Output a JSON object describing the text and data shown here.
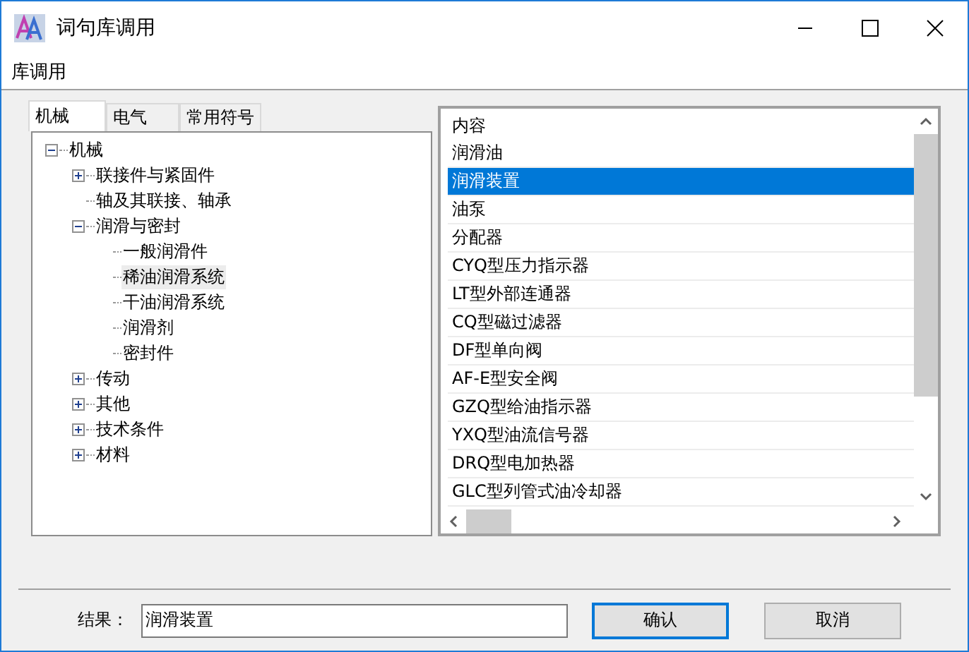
{
  "window": {
    "title": "词句库调用"
  },
  "menu": [
    "库调用"
  ],
  "tabs": [
    {
      "label": "机械",
      "selected": true
    },
    {
      "label": "电气",
      "selected": false
    },
    {
      "label": "常用符号",
      "selected": false
    }
  ],
  "tree": [
    {
      "label": "机械",
      "expanded": true,
      "selected": false,
      "children": [
        {
          "label": "联接件与紧固件",
          "expanded": false,
          "selected": false
        },
        {
          "label": "轴及其联接、轴承",
          "selected": false
        },
        {
          "label": "润滑与密封",
          "expanded": true,
          "selected": false,
          "children": [
            {
              "label": "一般润滑件",
              "selected": false
            },
            {
              "label": "稀油润滑系统",
              "selected": true
            },
            {
              "label": "干油润滑系统",
              "selected": false
            },
            {
              "label": "润滑剂",
              "selected": false
            },
            {
              "label": "密封件",
              "selected": false
            }
          ]
        },
        {
          "label": "传动",
          "expanded": false,
          "selected": false
        },
        {
          "label": "其他",
          "expanded": false,
          "selected": false
        },
        {
          "label": "技术条件",
          "expanded": false,
          "selected": false
        },
        {
          "label": "材料",
          "expanded": false,
          "selected": false
        }
      ]
    }
  ],
  "list": {
    "header": "内容",
    "rows": [
      {
        "text": "润滑油",
        "selected": false
      },
      {
        "text": "润滑装置",
        "selected": true
      },
      {
        "text": "油泵",
        "selected": false
      },
      {
        "text": "分配器",
        "selected": false
      },
      {
        "text": "CYQ型压力指示器",
        "selected": false
      },
      {
        "text": "LT型外部连通器",
        "selected": false
      },
      {
        "text": "CQ型磁过滤器",
        "selected": false
      },
      {
        "text": "DF型单向阀",
        "selected": false
      },
      {
        "text": "AF-E型安全阀",
        "selected": false
      },
      {
        "text": "GZQ型给油指示器",
        "selected": false
      },
      {
        "text": "YXQ型油流信号器",
        "selected": false
      },
      {
        "text": "DRQ型电加热器",
        "selected": false
      },
      {
        "text": "GLC型列管式油冷却器",
        "selected": false
      }
    ]
  },
  "result": {
    "label": "结果：",
    "value": "润滑装置"
  },
  "buttons": [
    {
      "label": "确认",
      "default": true
    },
    {
      "label": "取消",
      "default": false
    }
  ]
}
